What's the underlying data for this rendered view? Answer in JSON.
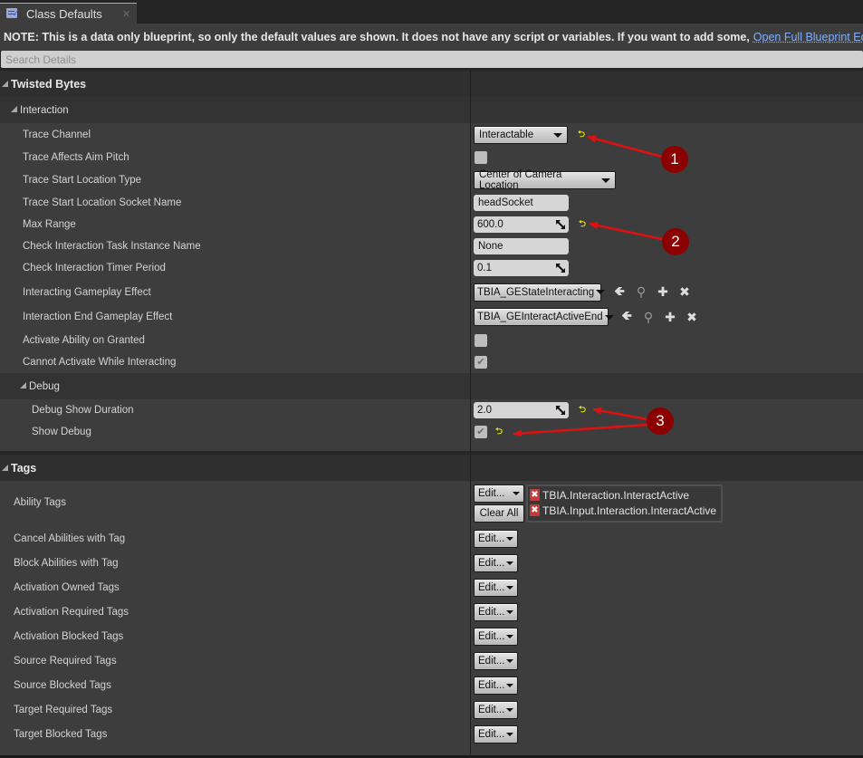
{
  "tab": {
    "icon": "blueprint-class-defaults-icon",
    "label": "Class Defaults",
    "close_glyph": "✕"
  },
  "note": {
    "text": "NOTE: This is a data only blueprint, so only the default values are shown.  It does not have any script or variables.  If you want to add some,",
    "link": "Open Full Blueprint Editor"
  },
  "search": {
    "placeholder": "Search Details",
    "value": ""
  },
  "categories": {
    "twisted_bytes": "Twisted Bytes",
    "interaction": "Interaction",
    "debug": "Debug",
    "tags": "Tags"
  },
  "properties": {
    "trace_channel": {
      "label": "Trace Channel",
      "value": "Interactable"
    },
    "trace_affects_aim_pitch": {
      "label": "Trace Affects Aim Pitch",
      "checked": false
    },
    "trace_start_location_type": {
      "label": "Trace Start Location Type",
      "value": "Center of Camera Location"
    },
    "trace_start_location_socket_name": {
      "label": "Trace Start Location Socket Name",
      "value": "headSocket"
    },
    "max_range": {
      "label": "Max Range",
      "value": "600.0"
    },
    "check_interaction_task_instance_name": {
      "label": "Check Interaction Task Instance Name",
      "value": "None"
    },
    "check_interaction_timer_period": {
      "label": "Check Interaction Timer Period",
      "value": "0.1"
    },
    "interacting_gameplay_effect": {
      "label": "Interacting Gameplay Effect",
      "value": "TBIA_GEStateInteracting"
    },
    "interaction_end_gameplay_effect": {
      "label": "Interaction End Gameplay Effect",
      "value": "TBIA_GEInteractActiveEnd"
    },
    "activate_ability_on_granted": {
      "label": "Activate Ability on Granted",
      "checked": false
    },
    "cannot_activate_while_interacting": {
      "label": "Cannot Activate While Interacting",
      "checked": true
    },
    "debug_show_duration": {
      "label": "Debug Show Duration",
      "value": "2.0"
    },
    "show_debug": {
      "label": "Show Debug",
      "checked": true
    }
  },
  "glyphs": {
    "reset": "⮌",
    "check": "✔",
    "use_selected": "🡸",
    "browse": "⚲",
    "add": "✚",
    "clear": "✖",
    "tag_remove": "✖"
  },
  "tags": {
    "edit_label": "Edit...",
    "clear_all_label": "Clear All",
    "ability_tags": {
      "label": "Ability Tags",
      "values": [
        "TBIA.Interaction.InteractActive",
        "TBIA.Input.Interaction.InteractActive"
      ]
    },
    "rows": [
      {
        "label": "Cancel Abilities with Tag"
      },
      {
        "label": "Block Abilities with Tag"
      },
      {
        "label": "Activation Owned Tags"
      },
      {
        "label": "Activation Required Tags"
      },
      {
        "label": "Activation Blocked Tags"
      },
      {
        "label": "Source Required Tags"
      },
      {
        "label": "Source Blocked Tags"
      },
      {
        "label": "Target Required Tags"
      },
      {
        "label": "Target Blocked Tags"
      }
    ]
  },
  "annotations": [
    {
      "number": "1"
    },
    {
      "number": "2"
    },
    {
      "number": "3"
    }
  ],
  "colors": {
    "annotation_badge": "#8b0000",
    "annotation_arrow": "#e01010",
    "reset_arrow": "#e6e600",
    "link": "#7fb0ff",
    "tab_accent": "#c9b43a"
  }
}
